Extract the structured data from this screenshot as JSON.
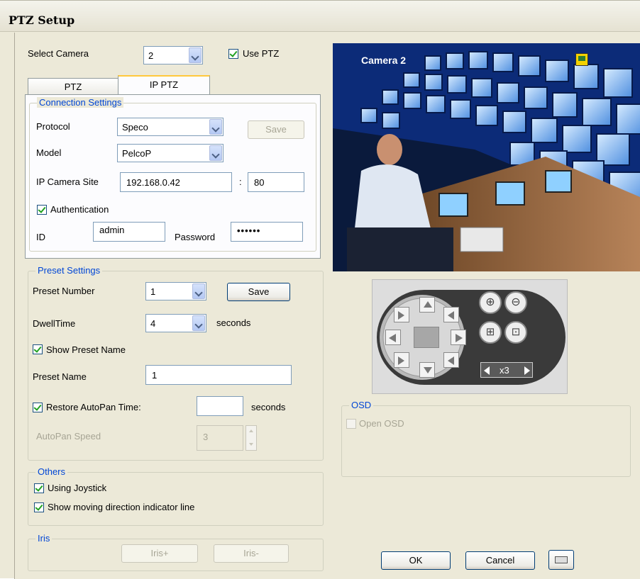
{
  "window": {
    "title": "PTZ Setup"
  },
  "camera_select": {
    "label": "Select Camera",
    "value": "2",
    "use_ptz_label": "Use PTZ",
    "use_ptz_checked": true
  },
  "tabs": [
    {
      "label": "PTZ",
      "active": false
    },
    {
      "label": "IP PTZ",
      "active": true
    }
  ],
  "connection": {
    "legend": "Connection Settings",
    "protocol_label": "Protocol",
    "protocol_value": "Speco",
    "save_label": "Save",
    "model_label": "Model",
    "model_value": "PelcoP",
    "ip_label": "IP Camera Site",
    "ip_value": "192.168.0.42",
    "port_separator": ":",
    "port_value": "80",
    "auth_label": "Authentication",
    "auth_checked": true,
    "id_label": "ID",
    "id_value": "admin",
    "password_label": "Password",
    "password_value": "••••••"
  },
  "preset": {
    "legend": "Preset Settings",
    "number_label": "Preset Number",
    "number_value": "1",
    "save_label": "Save",
    "dwell_label": "DwellTime",
    "dwell_value": "4",
    "dwell_unit": "seconds",
    "show_name_label": "Show Preset Name",
    "show_name_checked": true,
    "name_label": "Preset Name",
    "name_value": "1",
    "restore_label": "Restore AutoPan Time:",
    "restore_checked": true,
    "restore_value": "",
    "restore_unit": "seconds",
    "speed_label": "AutoPan Speed",
    "speed_value": "3"
  },
  "others": {
    "legend": "Others",
    "joystick_label": "Using Joystick",
    "joystick_checked": true,
    "indicator_label": "Show moving direction indicator line",
    "indicator_checked": true
  },
  "iris": {
    "legend": "Iris",
    "plus_label": "Iris+",
    "minus_label": "Iris-"
  },
  "camera_view": {
    "overlay_label": "Camera 2"
  },
  "ptz_pad": {
    "zoom_level": "x3"
  },
  "osd": {
    "legend": "OSD",
    "open_label": "Open OSD",
    "open_checked": false
  },
  "footer": {
    "ok_label": "OK",
    "cancel_label": "Cancel"
  }
}
